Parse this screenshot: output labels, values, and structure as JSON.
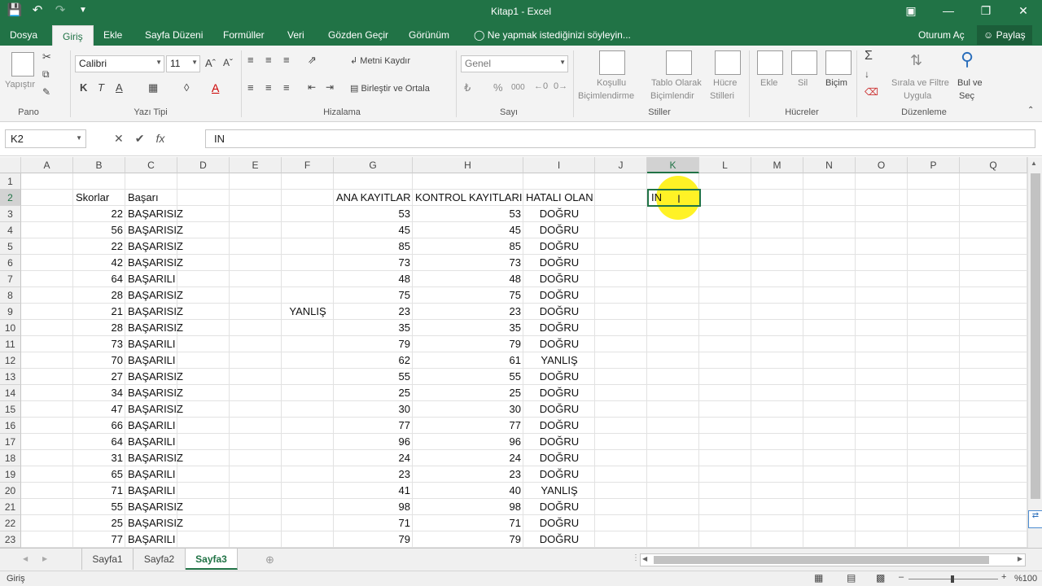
{
  "window": {
    "title": "Kitap1 - Excel"
  },
  "qat": {
    "save_icon": "save-icon",
    "undo_icon": "undo-icon",
    "redo_icon": "redo-icon",
    "customize_icon": "customize-qat-icon"
  },
  "tabs": {
    "file": "Dosya",
    "home": "Giriş",
    "insert": "Ekle",
    "layout": "Sayfa Düzeni",
    "formulas": "Formüller",
    "data": "Veri",
    "review": "Gözden Geçir",
    "view": "Görünüm",
    "tell": "Ne yapmak istediğinizi söyleyin...",
    "signin": "Oturum Aç",
    "share": "Paylaş"
  },
  "ribbon": {
    "clipboard": {
      "label": "Pano",
      "paste": "Yapıştır"
    },
    "font": {
      "label": "Yazı Tipi",
      "name": "Calibri",
      "size": "11",
      "bold": "K",
      "italic": "T",
      "underline": "A"
    },
    "alignment": {
      "label": "Hizalama",
      "wrap": "Metni Kaydır",
      "merge": "Birleştir ve Ortala"
    },
    "number": {
      "label": "Sayı",
      "format": "Genel",
      "percent": "%",
      "comma": "000"
    },
    "styles": {
      "label": "Stiller",
      "cond1": "Koşullu",
      "cond2": "Biçimlendirme",
      "table1": "Tablo Olarak",
      "table2": "Biçimlendir",
      "cell1": "Hücre",
      "cell2": "Stilleri"
    },
    "cells": {
      "label": "Hücreler",
      "insert": "Ekle",
      "delete": "Sil",
      "format": "Biçim"
    },
    "editing": {
      "label": "Düzenleme",
      "sort1": "Sırala ve Filtre",
      "sort2": "Uygula",
      "find1": "Bul ve",
      "find2": "Seç"
    }
  },
  "formula_bar": {
    "name_box": "K2",
    "cancel": "✕",
    "enter": "✔",
    "fx": "fx",
    "content": "IN"
  },
  "columns": [
    "A",
    "B",
    "C",
    "D",
    "E",
    "F",
    "G",
    "H",
    "I",
    "J",
    "K",
    "L",
    "M",
    "N",
    "O",
    "P",
    "Q"
  ],
  "rows": [
    "1",
    "2",
    "3",
    "4",
    "5",
    "6",
    "7",
    "8",
    "9",
    "10",
    "11",
    "12",
    "13",
    "14",
    "15",
    "16",
    "17",
    "18",
    "19",
    "20",
    "21",
    "22",
    "23"
  ],
  "headers": {
    "skor": "Skorlar",
    "basari": "Başarı",
    "ana": "ANA KAYITLAR",
    "kontrol": "KONTROL  KAYITLARI",
    "hatali": "HATALI OLAN"
  },
  "active_input": "IN",
  "f9": "YANLIŞ",
  "data_rows": [
    {
      "b": "22",
      "c": "BAŞARISIZ",
      "g": "53",
      "h": "53",
      "i": "DOĞRU"
    },
    {
      "b": "56",
      "c": "BAŞARISIZ",
      "g": "45",
      "h": "45",
      "i": "DOĞRU"
    },
    {
      "b": "22",
      "c": "BAŞARISIZ",
      "g": "85",
      "h": "85",
      "i": "DOĞRU"
    },
    {
      "b": "42",
      "c": "BAŞARISIZ",
      "g": "73",
      "h": "73",
      "i": "DOĞRU"
    },
    {
      "b": "64",
      "c": "BAŞARILI",
      "g": "48",
      "h": "48",
      "i": "DOĞRU"
    },
    {
      "b": "28",
      "c": "BAŞARISIZ",
      "g": "75",
      "h": "75",
      "i": "DOĞRU"
    },
    {
      "b": "21",
      "c": "BAŞARISIZ",
      "g": "23",
      "h": "23",
      "i": "DOĞRU"
    },
    {
      "b": "28",
      "c": "BAŞARISIZ",
      "g": "35",
      "h": "35",
      "i": "DOĞRU"
    },
    {
      "b": "73",
      "c": "BAŞARILI",
      "g": "79",
      "h": "79",
      "i": "DOĞRU"
    },
    {
      "b": "70",
      "c": "BAŞARILI",
      "g": "62",
      "h": "61",
      "i": "YANLIŞ"
    },
    {
      "b": "27",
      "c": "BAŞARISIZ",
      "g": "55",
      "h": "55",
      "i": "DOĞRU"
    },
    {
      "b": "34",
      "c": "BAŞARISIZ",
      "g": "25",
      "h": "25",
      "i": "DOĞRU"
    },
    {
      "b": "47",
      "c": "BAŞARISIZ",
      "g": "30",
      "h": "30",
      "i": "DOĞRU"
    },
    {
      "b": "66",
      "c": "BAŞARILI",
      "g": "77",
      "h": "77",
      "i": "DOĞRU"
    },
    {
      "b": "64",
      "c": "BAŞARILI",
      "g": "96",
      "h": "96",
      "i": "DOĞRU"
    },
    {
      "b": "31",
      "c": "BAŞARISIZ",
      "g": "24",
      "h": "24",
      "i": "DOĞRU"
    },
    {
      "b": "65",
      "c": "BAŞARILI",
      "g": "23",
      "h": "23",
      "i": "DOĞRU"
    },
    {
      "b": "71",
      "c": "BAŞARILI",
      "g": "41",
      "h": "40",
      "i": "YANLIŞ"
    },
    {
      "b": "55",
      "c": "BAŞARISIZ",
      "g": "98",
      "h": "98",
      "i": "DOĞRU"
    },
    {
      "b": "25",
      "c": "BAŞARISIZ",
      "g": "71",
      "h": "71",
      "i": "DOĞRU"
    },
    {
      "b": "77",
      "c": "BAŞARILI",
      "g": "79",
      "h": "79",
      "i": "DOĞRU"
    }
  ],
  "sheets": [
    "Sayfa1",
    "Sayfa2",
    "Sayfa3"
  ],
  "status": {
    "mode": "Giriş",
    "zoom": "%100"
  },
  "colors": {
    "accent": "#217346"
  }
}
